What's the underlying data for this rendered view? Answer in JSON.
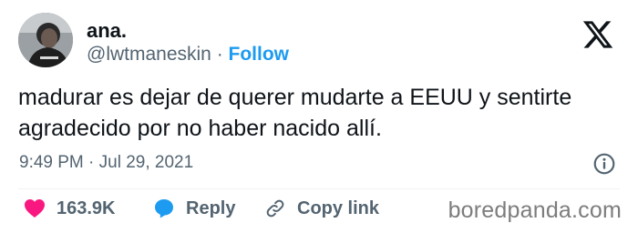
{
  "author": {
    "name": "ana.",
    "handle": "@lwtmaneskin",
    "separator": " · ",
    "follow_label": "Follow"
  },
  "tweet": {
    "text_line1": "madurar es dejar de querer mudarte a EEUU y sentirte",
    "text_line2": "agradecido por no haber nacido allí.",
    "timestamp": "9:49 PM · Jul 29, 2021"
  },
  "actions": {
    "likes": "163.9K",
    "reply_label": "Reply",
    "copy_link_label": "Copy link"
  },
  "icons": {
    "platform": "x-logo-icon",
    "info": "info-icon",
    "like": "heart-icon",
    "reply": "speech-bubble-icon",
    "copy": "link-icon"
  },
  "colors": {
    "like": "#f91880",
    "reply": "#1d9bf0",
    "link": "#1d9bf0",
    "secondary_text": "#536471"
  },
  "watermark": "boredpanda.com"
}
